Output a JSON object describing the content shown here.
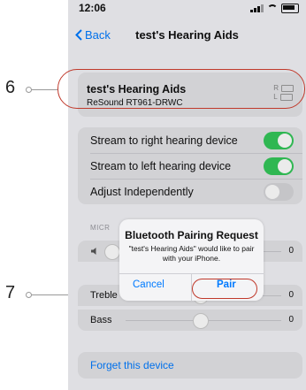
{
  "status": {
    "time": "12:06"
  },
  "nav": {
    "back_label": "Back",
    "title": "test's Hearing Aids"
  },
  "device": {
    "name": "test's Hearing Aids",
    "model": "ReSound RT961-DRWC",
    "right_label": "R",
    "left_label": "L"
  },
  "callouts": {
    "six": "6",
    "seven": "7"
  },
  "settings": {
    "stream_right": {
      "label": "Stream to right hearing device",
      "on": true
    },
    "stream_left": {
      "label": "Stream to left hearing device",
      "on": true
    },
    "adjust_independently": {
      "label": "Adjust Independently",
      "on": false
    }
  },
  "mic_section_label": "MICR",
  "sliders": {
    "mic": {
      "label": "",
      "value": "0",
      "level": 0.1
    },
    "treble": {
      "label": "Treble",
      "value": "0",
      "level": 0.5
    },
    "bass": {
      "label": "Bass",
      "value": "0",
      "level": 0.5
    }
  },
  "forget_label": "Forget this device",
  "dialog": {
    "title": "Bluetooth Pairing Request",
    "message": "\"test's Hearing Aids\" would like to pair with your iPhone.",
    "cancel": "Cancel",
    "pair": "Pair"
  }
}
